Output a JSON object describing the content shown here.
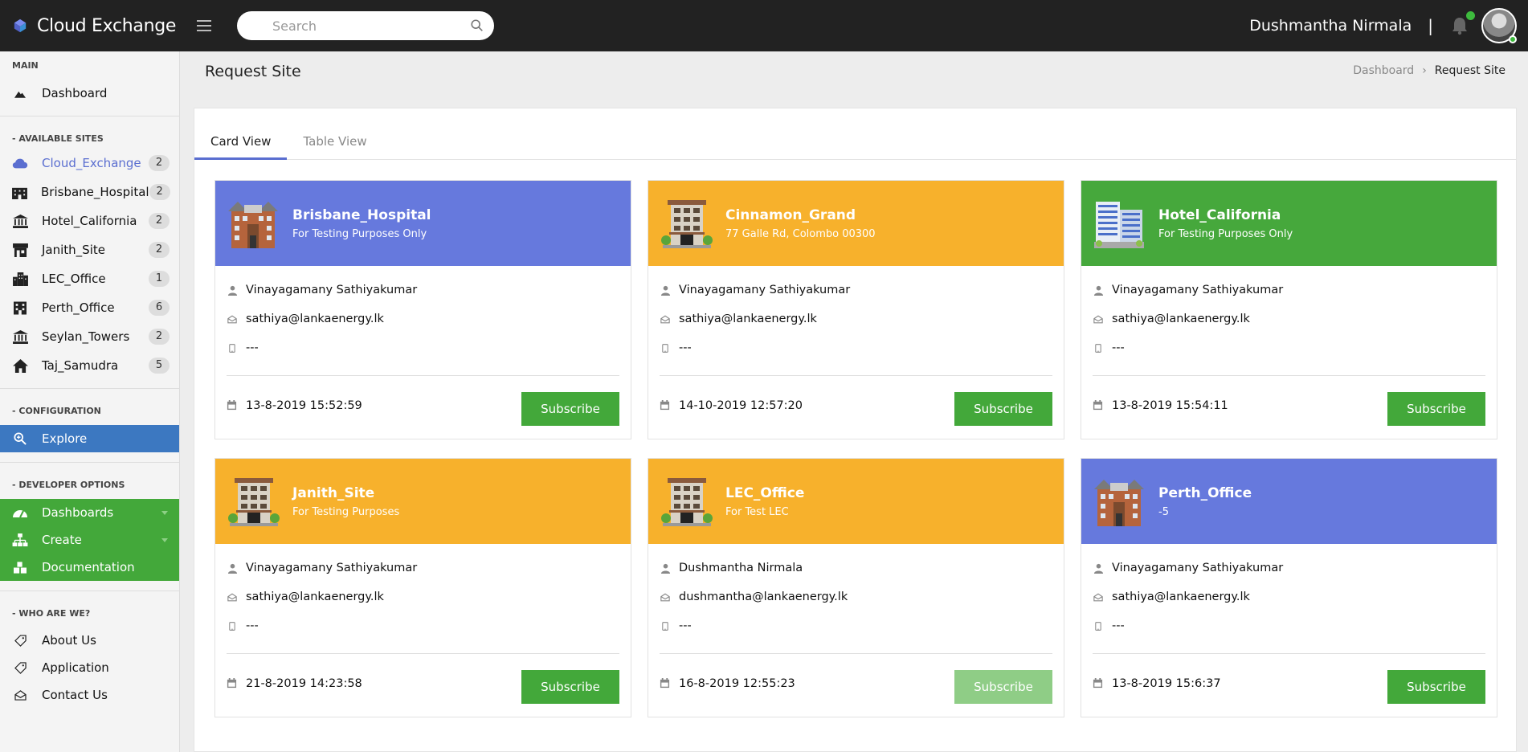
{
  "header": {
    "app_title": "Cloud Exchange",
    "search_placeholder": "Search",
    "user_name": "Dushmantha Nirmala",
    "separator": "|"
  },
  "sidebar": {
    "main_title": "MAIN",
    "dashboard": "Dashboard",
    "sites_title": "- AVAILABLE SITES",
    "sites": [
      {
        "label": "Cloud_Exchange",
        "count": "2"
      },
      {
        "label": "Brisbane_Hospital",
        "count": "2"
      },
      {
        "label": "Hotel_California",
        "count": "2"
      },
      {
        "label": "Janith_Site",
        "count": "2"
      },
      {
        "label": "LEC_Office",
        "count": "1"
      },
      {
        "label": "Perth_Office",
        "count": "6"
      },
      {
        "label": "Seylan_Towers",
        "count": "2"
      },
      {
        "label": "Taj_Samudra",
        "count": "5"
      }
    ],
    "config_title": "- CONFIGURATION",
    "explore": "Explore",
    "dev_title": "- DEVELOPER OPTIONS",
    "dev": [
      "Dashboards",
      "Create",
      "Documentation"
    ],
    "who_title": "- WHO ARE WE?",
    "who": [
      "About Us",
      "Application",
      "Contact Us"
    ]
  },
  "page": {
    "title": "Request Site",
    "breadcrumb": [
      "Dashboard",
      "Request Site"
    ],
    "tabs": [
      "Card View",
      "Table View"
    ]
  },
  "cards": [
    {
      "title": "Brisbane_Hospital",
      "subtitle": "For Testing Purposes Only",
      "color": "#6679dd",
      "name": "Vinayagamany Sathiyakumar",
      "email": "sathiya@lankaenergy.lk",
      "phone": "---",
      "date": "13-8-2019 15:52:59",
      "button": "Subscribe"
    },
    {
      "title": "Cinnamon_Grand",
      "subtitle": "77 Galle Rd, Colombo 00300",
      "color": "#f7b12c",
      "name": "Vinayagamany Sathiyakumar",
      "email": "sathiya@lankaenergy.lk",
      "phone": "---",
      "date": "14-10-2019 12:57:20",
      "button": "Subscribe"
    },
    {
      "title": "Hotel_California",
      "subtitle": "For Testing Purposes Only",
      "color": "#46a83c",
      "name": "Vinayagamany Sathiyakumar",
      "email": "sathiya@lankaenergy.lk",
      "phone": "---",
      "date": "13-8-2019 15:54:11",
      "button": "Subscribe"
    },
    {
      "title": "Janith_Site",
      "subtitle": "For Testing Purposes",
      "color": "#f7b12c",
      "name": "Vinayagamany Sathiyakumar",
      "email": "sathiya@lankaenergy.lk",
      "phone": "---",
      "date": "21-8-2019 14:23:58",
      "button": "Subscribe"
    },
    {
      "title": "LEC_Office",
      "subtitle": "For Test LEC",
      "color": "#f7b12c",
      "name": "Dushmantha Nirmala",
      "email": "dushmantha@lankaenergy.lk",
      "phone": "---",
      "date": "16-8-2019 12:55:23",
      "button": "Subscribe"
    },
    {
      "title": "Perth_Office",
      "subtitle": "-5",
      "color": "#6679dd",
      "name": "Vinayagamany Sathiyakumar",
      "email": "sathiya@lankaenergy.lk",
      "phone": "---",
      "date": "13-8-2019 15:6:37",
      "button": "Subscribe"
    }
  ]
}
